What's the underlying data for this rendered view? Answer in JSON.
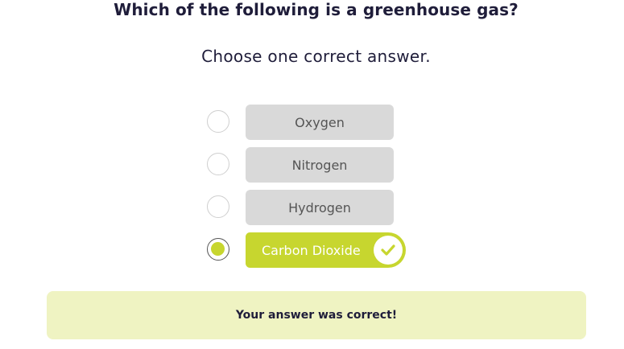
{
  "quiz": {
    "question": "Which of the following is a greenhouse gas?",
    "instruction": "Choose one correct answer.",
    "options": [
      {
        "label": "Oxygen",
        "selected": false,
        "correct": false
      },
      {
        "label": "Nitrogen",
        "selected": false,
        "correct": false
      },
      {
        "label": "Hydrogen",
        "selected": false,
        "correct": false
      },
      {
        "label": "Carbon Dioxide",
        "selected": true,
        "correct": true
      }
    ],
    "feedback": "Your answer was correct!"
  },
  "colors": {
    "accent": "#c7d62f",
    "option_bg": "#d9d9d9",
    "feedback_bg": "#eff3c2",
    "text": "#1f1d3a"
  },
  "icons": {
    "correct_badge": "check-icon"
  }
}
